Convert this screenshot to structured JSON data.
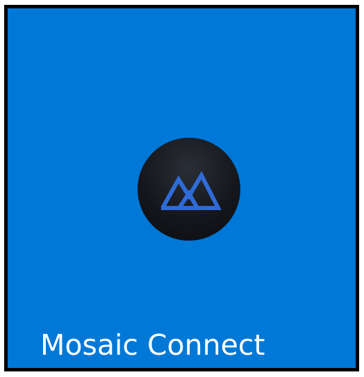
{
  "tile": {
    "label": "Mosaic Connect",
    "background_color": "#0078d7",
    "label_color": "#ffffff"
  },
  "logo": {
    "icon": "mountain-peaks-icon",
    "circle_color": "#15171c",
    "mark_color": "#2f6bd8"
  }
}
